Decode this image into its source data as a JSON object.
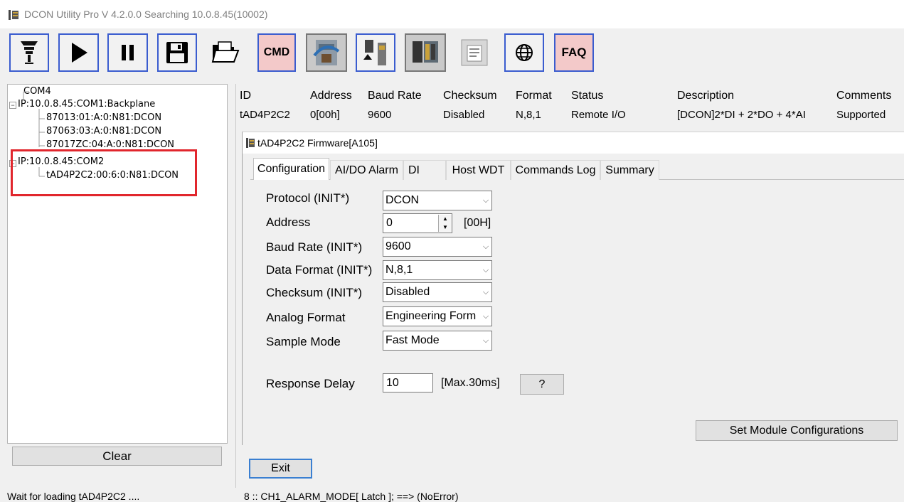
{
  "window": {
    "title": "DCON Utility Pro  V 4.2.0.0 Searching 10.0.8.45(10002)"
  },
  "toolbar": {
    "buttons": [
      {
        "name": "search-module",
        "icon": "module-search-icon"
      },
      {
        "name": "start",
        "icon": "play-icon"
      },
      {
        "name": "pause",
        "icon": "pause-icon"
      },
      {
        "name": "save",
        "icon": "floppy-disk-icon"
      },
      {
        "name": "open",
        "icon": "open-folder-icon"
      },
      {
        "name": "cmd",
        "label": "CMD"
      },
      {
        "name": "module-config",
        "icon": "module-config-icon"
      },
      {
        "name": "module-io",
        "icon": "module-io-icon"
      },
      {
        "name": "module-scan",
        "icon": "module-scan-icon"
      },
      {
        "name": "firmware",
        "icon": "firmware-icon"
      },
      {
        "name": "web",
        "icon": "globe-icon"
      },
      {
        "name": "faq",
        "label": "FAQ"
      }
    ]
  },
  "tree": {
    "items": [
      "COM4",
      "IP:10.0.8.45:COM1:Backplane",
      "87013:01:A:0:N81:DCON",
      "87063:03:A:0:N81:DCON",
      "87017ZC:04:A:0:N81:DCON",
      "IP:10.0.8.45:COM2",
      "tAD4P2C2:00:6:0:N81:DCON"
    ],
    "clear_label": "Clear"
  },
  "module_table": {
    "headers": [
      "ID",
      "Address",
      "Baud Rate",
      "Checksum",
      "Format",
      "Status",
      "Description",
      "Comments"
    ],
    "row": [
      "tAD4P2C2",
      "0[00h]",
      "9600",
      "Disabled",
      "N,8,1",
      "Remote I/O",
      "[DCON]2*DI + 2*DO + 4*AI",
      "Supported"
    ]
  },
  "dialog": {
    "title": "tAD4P2C2 Firmware[A105]",
    "tabs": [
      "Configuration",
      "AI/DO Alarm",
      "DI",
      "Host WDT",
      "Commands Log",
      "Summary"
    ],
    "active_tab": "Configuration",
    "fields": {
      "protocol": {
        "label": "Protocol (INIT*)",
        "value": "DCON"
      },
      "address": {
        "label": "Address",
        "value": "0",
        "hex": "[00H]"
      },
      "baud_rate": {
        "label": "Baud Rate (INIT*)",
        "value": "9600"
      },
      "data_format": {
        "label": "Data Format (INIT*)",
        "value": "N,8,1"
      },
      "checksum": {
        "label": "Checksum (INIT*)",
        "value": "Disabled"
      },
      "analog_format": {
        "label": "Analog Format",
        "value": "Engineering Form"
      },
      "sample_mode": {
        "label": "Sample Mode",
        "value": "Fast Mode"
      },
      "response_delay": {
        "label": "Response Delay",
        "value": "10",
        "max": "[Max.30ms]",
        "help": "?"
      }
    },
    "set_config_label": "Set Module Configurations",
    "exit_label": "Exit"
  },
  "status": {
    "left": "Wait for loading tAD4P2C2 ....",
    "right": "8 :: CH1_ALARM_MODE[ Latch ]; ==> (NoError)"
  },
  "colors": {
    "highlight": "#e1262d",
    "button_border": "#3a5ccf",
    "text_button_bg": "#f3c9c9"
  }
}
